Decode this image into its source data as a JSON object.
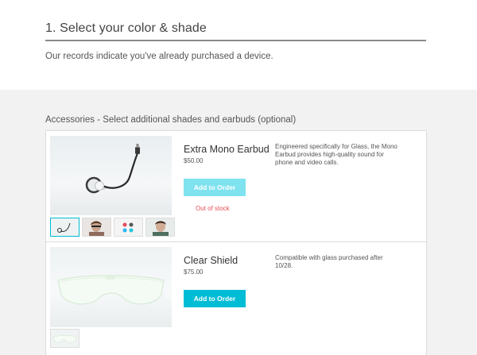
{
  "step": {
    "title": "1. Select your color & shade",
    "note": "Our records indicate you've already purchased a device."
  },
  "accessories": {
    "heading": "Accessories - Select additional shades and earbuds (optional)",
    "products": [
      {
        "name": "Extra Mono Earbud",
        "price": "$50.00",
        "description": "Engineered specifically for Glass, the Mono Earbud provides high-quality sound for phone and video calls.",
        "button_label": "Add to Order",
        "button_state": "disabled",
        "stock_status": "Out of stock",
        "thumbnails": [
          "earbud-thumb",
          "person-thumb",
          "colors-thumb",
          "person-thumb-2"
        ]
      },
      {
        "name": "Clear Shield",
        "price": "$75.00",
        "description": "Compatible with glass purchased after 10/28.",
        "button_label": "Add to Order",
        "button_state": "enabled",
        "thumbnails": [
          "shield-thumb"
        ]
      }
    ]
  },
  "colors": {
    "accent": "#00bcd4",
    "accent_disabled": "#7fe2ef",
    "out_of_stock": "#e8505b",
    "background_gray": "#f2f2f2"
  }
}
